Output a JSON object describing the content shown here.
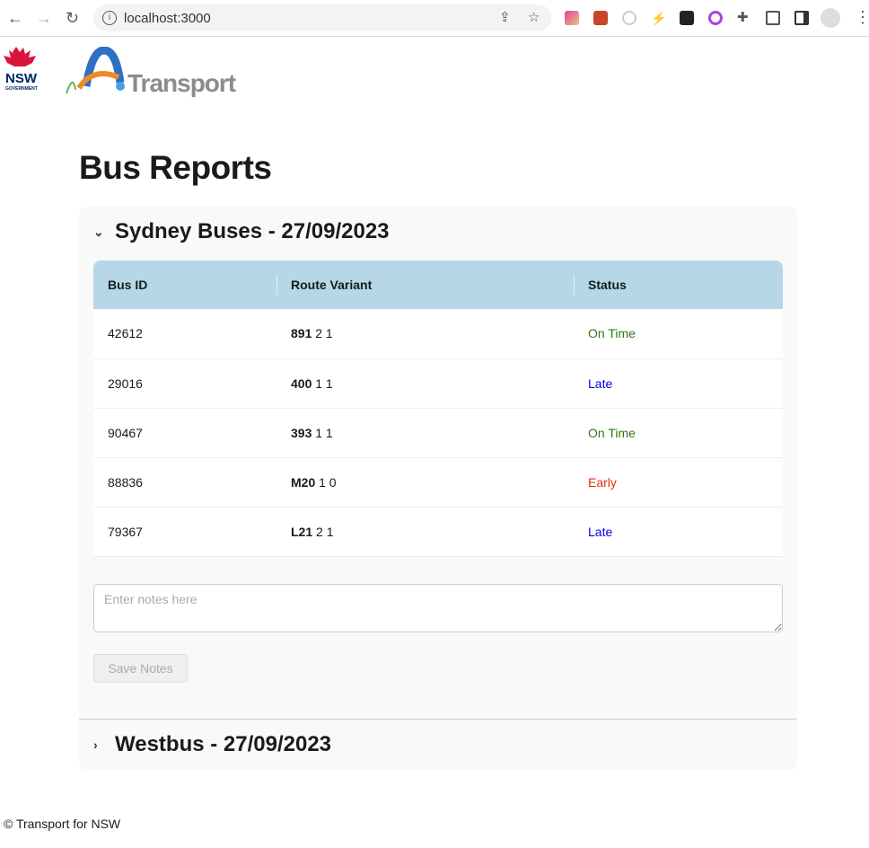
{
  "browser": {
    "url": "localhost:3000"
  },
  "logos": {
    "nsw": "NSW GOVERNMENT",
    "transport": "Transport"
  },
  "page": {
    "title": "Bus Reports"
  },
  "reports": [
    {
      "title": "Sydney Buses - 27/09/2023",
      "expanded": true,
      "columns": [
        "Bus ID",
        "Route Variant",
        "Status"
      ],
      "rows": [
        {
          "id": "42612",
          "route": "891",
          "variant": "2 1",
          "status": "On Time",
          "cls": "on"
        },
        {
          "id": "29016",
          "route": "400",
          "variant": "1 1",
          "status": "Late",
          "cls": "late"
        },
        {
          "id": "90467",
          "route": "393",
          "variant": "1 1",
          "status": "On Time",
          "cls": "on"
        },
        {
          "id": "88836",
          "route": "M20",
          "variant": "1 0",
          "status": "Early",
          "cls": "early"
        },
        {
          "id": "79367",
          "route": "L21",
          "variant": "2 1",
          "status": "Late",
          "cls": "late"
        }
      ],
      "notes_placeholder": "Enter notes here",
      "save_label": "Save Notes"
    },
    {
      "title": "Westbus - 27/09/2023",
      "expanded": false
    }
  ],
  "colors": {
    "on_time": "#2a7a10",
    "late": "#0000ee",
    "early": "#e0300a",
    "header_bg": "#b6d7e6"
  },
  "footer": "© Transport for NSW"
}
